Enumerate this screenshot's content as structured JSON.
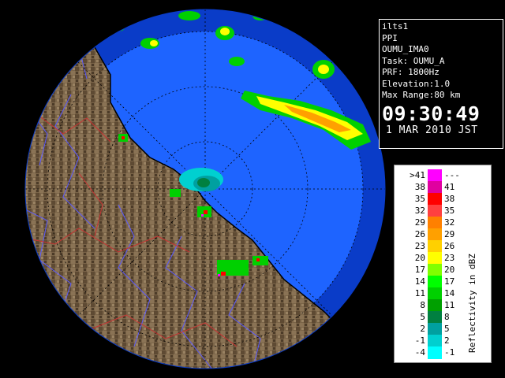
{
  "info": {
    "station": "ilts1",
    "scan_type": "PPI",
    "site": "OUMU_IMA0",
    "task": "Task: OUMU_A",
    "prf": "PRF: 1800Hz",
    "elevation": "Elevation:1.0",
    "max_range": "Max Range:80 km",
    "time": "09:30:49",
    "date": "1 MAR 2010 JST"
  },
  "legend": {
    "title": "Reflectivity in dBZ",
    "rows": [
      {
        "lo": ">41",
        "hi": "---",
        "color": "#ff00ff"
      },
      {
        "lo": "38",
        "hi": "41",
        "color": "#e000a0"
      },
      {
        "lo": "35",
        "hi": "38",
        "color": "#ff0000"
      },
      {
        "lo": "32",
        "hi": "35",
        "color": "#ff4040"
      },
      {
        "lo": "29",
        "hi": "32",
        "color": "#ff8000"
      },
      {
        "lo": "26",
        "hi": "29",
        "color": "#ffa000"
      },
      {
        "lo": "23",
        "hi": "26",
        "color": "#ffd000"
      },
      {
        "lo": "20",
        "hi": "23",
        "color": "#ffff00"
      },
      {
        "lo": "17",
        "hi": "20",
        "color": "#80ff00"
      },
      {
        "lo": "14",
        "hi": "17",
        "color": "#00ff00"
      },
      {
        "lo": "11",
        "hi": "14",
        "color": "#00d000"
      },
      {
        "lo": "8",
        "hi": "11",
        "color": "#00a000"
      },
      {
        "lo": "5",
        "hi": "8",
        "color": "#008040"
      },
      {
        "lo": "2",
        "hi": "5",
        "color": "#00a0a0"
      },
      {
        "lo": "-1",
        "hi": "2",
        "color": "#00d0d0"
      },
      {
        "lo": "-4",
        "hi": "-1",
        "color": "#00ffff"
      }
    ]
  },
  "colors": {
    "sea_near": "#1e64ff",
    "sea_far": "#0a3cc8",
    "land": "#7a6448",
    "background": "#000000"
  }
}
